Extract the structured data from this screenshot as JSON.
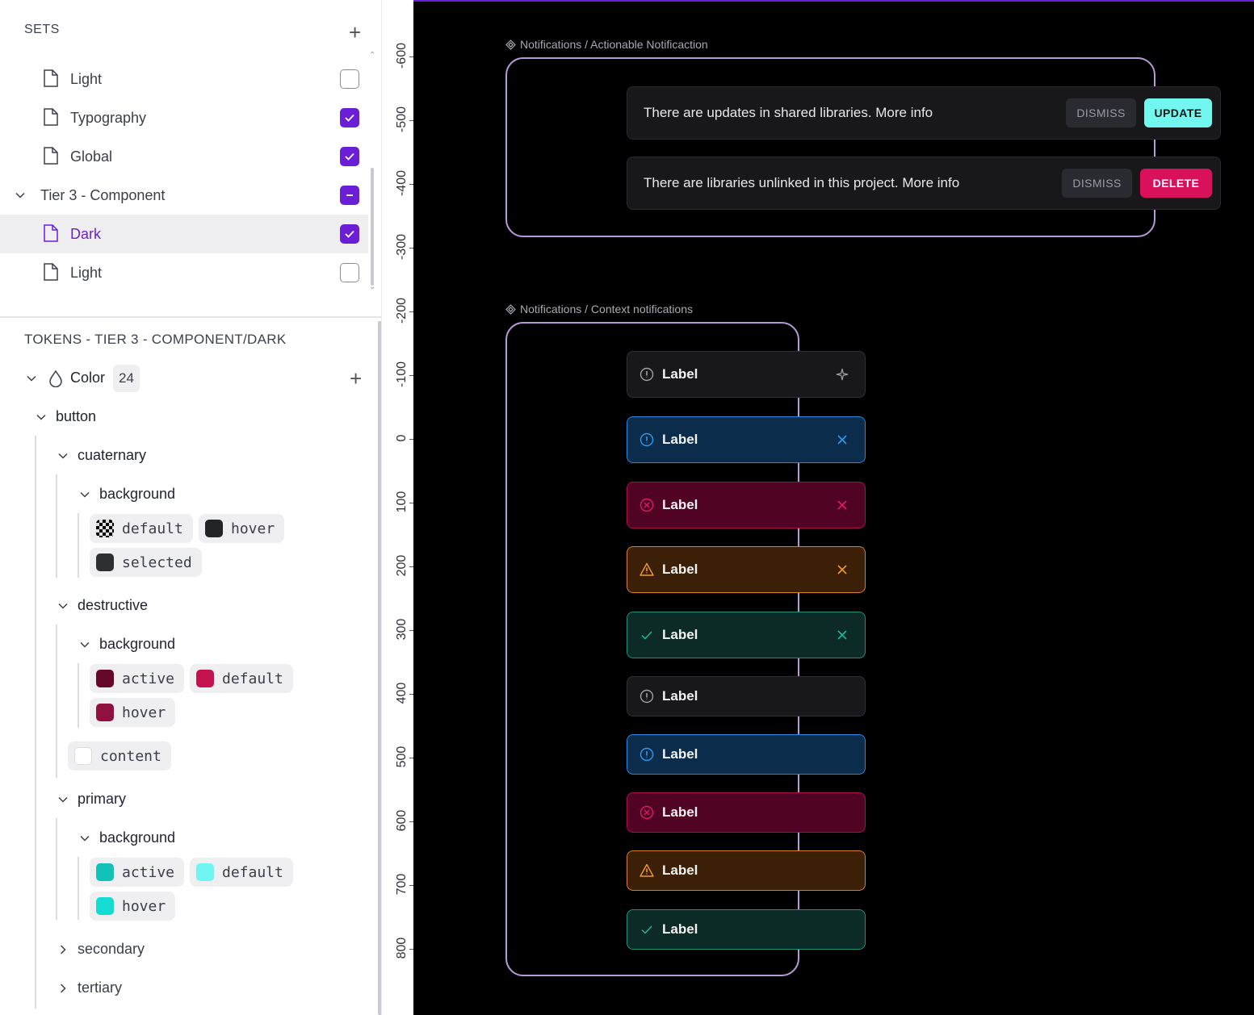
{
  "sets": {
    "header": "SETS",
    "add_icon": "plus-icon",
    "items": [
      {
        "label": "Light",
        "checked": "false"
      },
      {
        "label": "Typography",
        "checked": "true"
      },
      {
        "label": "Global",
        "checked": "true"
      },
      {
        "label": "Tier 3 - Component",
        "checked": "partial",
        "group": true
      },
      {
        "label": "Dark",
        "checked": "true",
        "active": true
      },
      {
        "label": "Light",
        "checked": "false"
      }
    ]
  },
  "tokens": {
    "header": "TOKENS - TIER 3 - COMPONENT/DARK",
    "color_group": {
      "label": "Color",
      "count": "24"
    },
    "button": "button",
    "cuaternary": {
      "label": "cuaternary",
      "background": "background",
      "items": [
        {
          "label": "default",
          "color": "checker"
        },
        {
          "label": "hover",
          "color": "#232427"
        },
        {
          "label": "selected",
          "color": "#2e2f33"
        }
      ]
    },
    "destructive": {
      "label": "destructive",
      "background": "background",
      "items": [
        {
          "label": "active",
          "color": "#66082a"
        },
        {
          "label": "default",
          "color": "#c4124f"
        },
        {
          "label": "hover",
          "color": "#90113f"
        }
      ],
      "content": {
        "label": "content",
        "color": "#ffffff"
      }
    },
    "primary": {
      "label": "primary",
      "background": "background",
      "items": [
        {
          "label": "active",
          "color": "#12c2b8"
        },
        {
          "label": "default",
          "color": "#6ff5f2"
        },
        {
          "label": "hover",
          "color": "#14dcd2"
        }
      ]
    },
    "secondary": "secondary",
    "tertiary": "tertiary"
  },
  "ruler": {
    "labels": [
      "-600",
      "-500",
      "-400",
      "-300",
      "-200",
      "-100",
      "0",
      "100",
      "200",
      "300",
      "400",
      "500",
      "600",
      "700",
      "800"
    ]
  },
  "canvas": {
    "actionable": {
      "caption": "Notifications / Actionable Notificaction",
      "notifications": [
        {
          "text": "There are updates in shared libraries. More info",
          "dismiss": "DISMISS",
          "action": "UPDATE"
        },
        {
          "text": "There are libraries unlinked in this project. More info",
          "dismiss": "DISMISS",
          "action": "DELETE"
        }
      ]
    },
    "context": {
      "caption": "Notifications / Context notifications",
      "items": [
        {
          "label": "Label",
          "variant": "neutral",
          "icon": "info-circle-icon",
          "action": "sparkle-icon"
        },
        {
          "label": "Label",
          "variant": "info",
          "icon": "info-circle-icon",
          "action": "close-icon"
        },
        {
          "label": "Label",
          "variant": "error",
          "icon": "error-circle-icon",
          "action": "close-icon"
        },
        {
          "label": "Label",
          "variant": "warning",
          "icon": "warning-triangle-icon",
          "action": "close-icon"
        },
        {
          "label": "Label",
          "variant": "success",
          "icon": "check-icon",
          "action": "close-icon"
        },
        {
          "label": "Label",
          "variant": "neutral",
          "icon": "info-circle-icon"
        },
        {
          "label": "Label",
          "variant": "info",
          "icon": "info-circle-icon"
        },
        {
          "label": "Label",
          "variant": "error",
          "icon": "error-circle-icon"
        },
        {
          "label": "Label",
          "variant": "warning",
          "icon": "warning-triangle-icon"
        },
        {
          "label": "Label",
          "variant": "success",
          "icon": "check-icon"
        }
      ]
    }
  },
  "colors": {
    "accent": "#6a1fd6",
    "frame_border": "#b89ad6",
    "update_button": "#72f7f0",
    "delete_button": "#d8115a"
  }
}
